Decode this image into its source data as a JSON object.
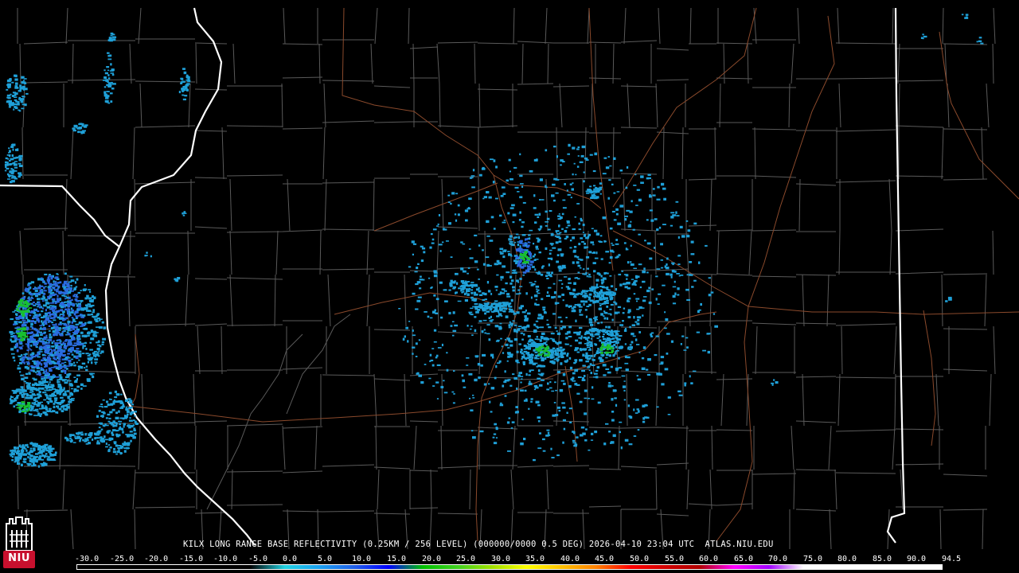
{
  "caption": {
    "product": "KILX LONG RANGE BASE REFLECTIVITY (0.25KM / 256 LEVEL) (000000/0000 0.5 DEG) 2026-04-10 23:04 UTC",
    "source": "ATLAS.NIU.EDU"
  },
  "logo": {
    "text": "NIU",
    "color": "#c8102e"
  },
  "scale": {
    "ticks": [
      "-30.0",
      "-25.0",
      "-20.0",
      "-15.0",
      "-10.0",
      "-5.0",
      "0.0",
      "5.0",
      "10.0",
      "15.0",
      "20.0",
      "25.0",
      "30.0",
      "35.0",
      "40.0",
      "45.0",
      "50.0",
      "55.0",
      "60.0",
      "65.0",
      "70.0",
      "75.0",
      "80.0",
      "85.0",
      "90.0",
      "94.5"
    ],
    "colors": [
      "#000000",
      "#000000",
      "#000000",
      "#000000",
      "#000000",
      "#000000",
      "#20d0e0",
      "#1aa0f0",
      "#2060e8",
      "#0000ff",
      "#00c000",
      "#40d020",
      "#a0e000",
      "#ffff00",
      "#ffc000",
      "#ff8000",
      "#ff0000",
      "#d00000",
      "#b00000",
      "#ff00ff",
      "#a000ff",
      "#ffffff",
      "#ffffff",
      "#ffffff",
      "#ffffff",
      "#ffffff"
    ]
  },
  "colors": {
    "background": "#000000",
    "county_lines": "#5a5a5a",
    "state_lines": "#ffffff",
    "highways": "#8b4a2c",
    "echo_light": "#1fa0d8",
    "echo_medium": "#2a6ae0",
    "echo_strong": "#18c030"
  }
}
